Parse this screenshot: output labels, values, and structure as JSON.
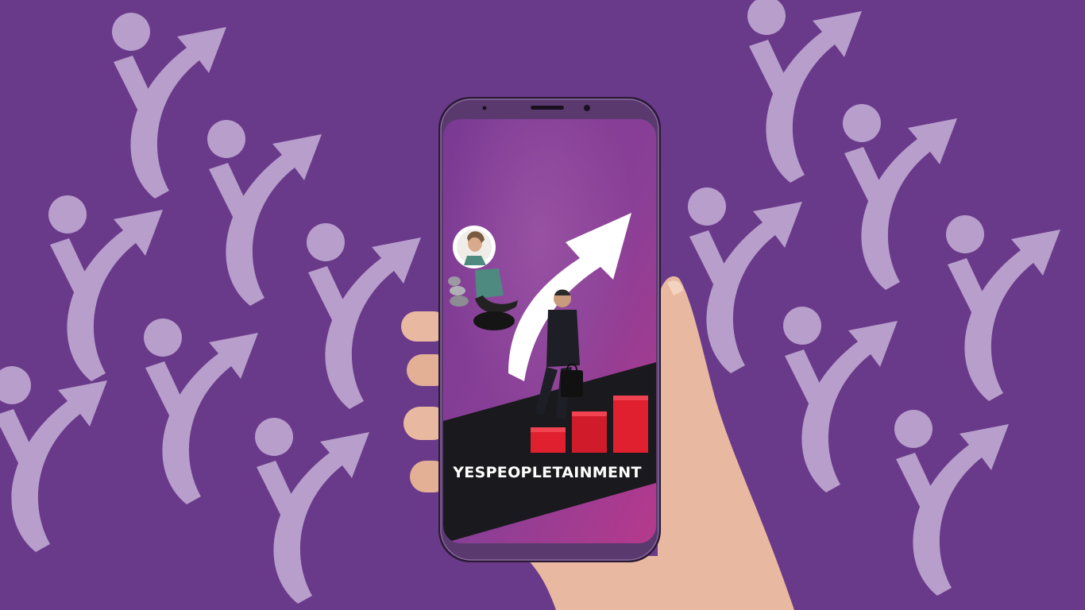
{
  "brand": {
    "name": "YESPEOPLETAINMENT"
  },
  "colors": {
    "background": "#6a3a8a",
    "pattern": "#b79ecb",
    "phone_frame": "#5a3a6e",
    "screen_purple": "#8a3f96",
    "screen_magenta": "#b6398c",
    "band_dark": "#1a1a1e",
    "bars_red": "#e0202e",
    "skin": "#e8b9a0"
  },
  "icons": [
    "info-arrow-logo-icon",
    "growth-arrow-icon",
    "bar-chart-icon"
  ]
}
